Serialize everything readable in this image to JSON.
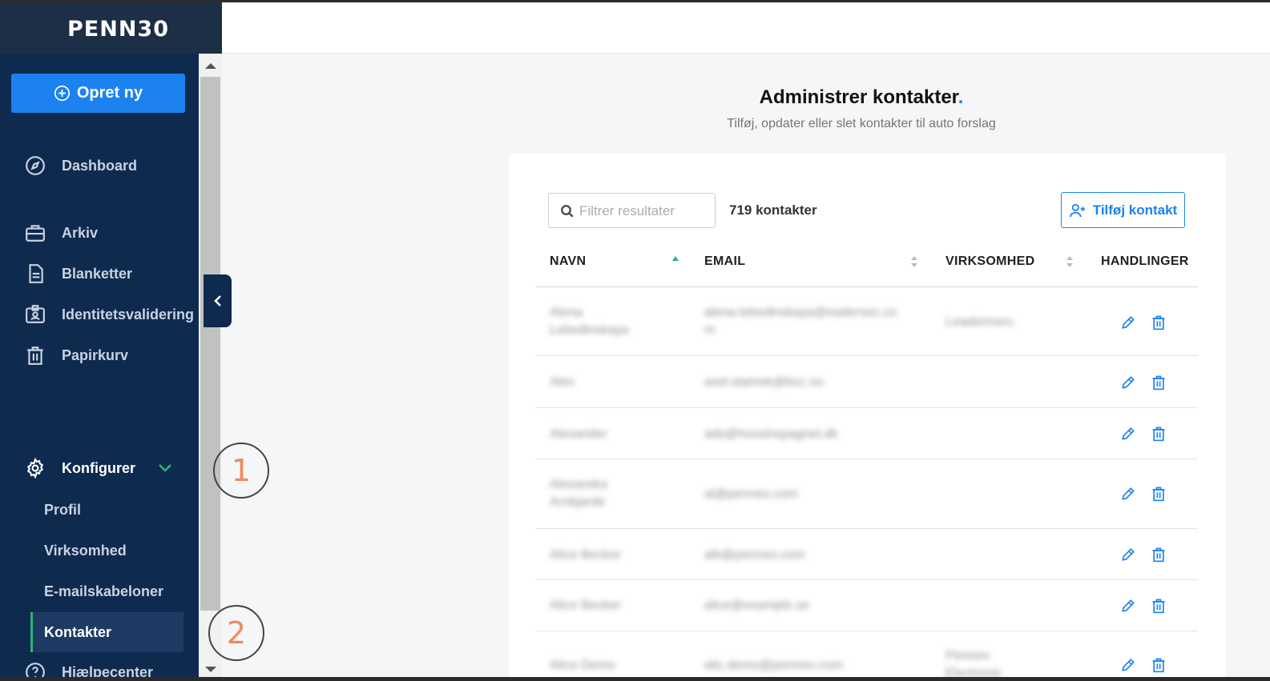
{
  "brand": {
    "logo": "PENN30"
  },
  "sidebar": {
    "create_label": "Opret ny",
    "items": [
      {
        "label": "Dashboard",
        "icon": "compass-icon"
      },
      {
        "label": "Arkiv",
        "icon": "briefcase-icon"
      },
      {
        "label": "Blanketter",
        "icon": "document-icon"
      },
      {
        "label": "Identitetsvalidering",
        "icon": "id-card-icon"
      },
      {
        "label": "Papirkurv",
        "icon": "trash-icon"
      }
    ],
    "configure": {
      "label": "Konfigurer",
      "icon": "gear-icon"
    },
    "sub_items": [
      {
        "label": "Profil"
      },
      {
        "label": "Virksomhed"
      },
      {
        "label": "E-mailskabeloner"
      },
      {
        "label": "Kontakter",
        "active": true
      }
    ],
    "help": {
      "label": "Hjælpecenter",
      "icon": "help-icon"
    }
  },
  "callouts": [
    "1",
    "2"
  ],
  "main": {
    "title": "Administrer kontakter",
    "title_dot": ".",
    "subtitle": "Tilføj, opdater eller slet kontakter til auto forslag",
    "search_placeholder": "Filtrer resultater",
    "count": "719 kontakter",
    "add_label": "Tilføj kontakt",
    "columns": [
      "NAVN",
      "EMAIL",
      "VIRKSOMHED",
      "HANDLINGER"
    ],
    "rows": [
      {
        "name": [
          "Alena",
          "Lebedinskaya"
        ],
        "email": [
          "alena.lebedinskaya@eadersec.co",
          "m"
        ],
        "company": [
          "Leadermerc"
        ]
      },
      {
        "name": [
          "Alex"
        ],
        "email": [
          "axel.stamek@bcc.no"
        ],
        "company": []
      },
      {
        "name": [
          "Alexander"
        ],
        "email": [
          "ads@hussinspagnet.dk"
        ],
        "company": []
      },
      {
        "name": [
          "Alexandra",
          "Arnbjarde"
        ],
        "email": [
          "al@penneo.com"
        ],
        "company": []
      },
      {
        "name": [
          "Alice Becker"
        ],
        "email": [
          "alb@penneo.com"
        ],
        "company": []
      },
      {
        "name": [
          "Alice Becker"
        ],
        "email": [
          "alice@example.se"
        ],
        "company": []
      },
      {
        "name": [
          "Alice Demo"
        ],
        "email": [
          "alic.demo@penneo.com"
        ],
        "company": [
          "Penneo",
          "Electronic"
        ]
      }
    ]
  },
  "colors": {
    "sidebar": "#0f2a4f",
    "accent": "#1b82f0",
    "sort_active": "#2bb673",
    "callout_text": "#ee8a5b"
  }
}
